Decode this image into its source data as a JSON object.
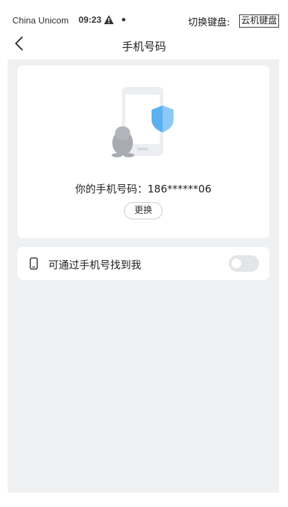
{
  "status_bar": {
    "carrier": "China Unicom",
    "time": "09:23",
    "icons": [
      "warning-icon",
      "dot-icon"
    ],
    "switch_keyboard_label": "切换键盘:",
    "cloud_keyboard_label": "云机键盘"
  },
  "nav": {
    "back_icon": "chevron-left-icon",
    "title": "手机号码"
  },
  "phone_card": {
    "illustration": "phone-shield-penguin-illustration",
    "phone_text": "你的手机号码：186******06",
    "change_button": "更换"
  },
  "find_me_row": {
    "icon": "mobile-icon",
    "label": "可通过手机号找到我",
    "toggle_on": false
  },
  "colors": {
    "background": "#eef0f2",
    "card": "#ffffff",
    "shield": "#5bb0f0",
    "toggle_off": "#e3e5e8"
  }
}
